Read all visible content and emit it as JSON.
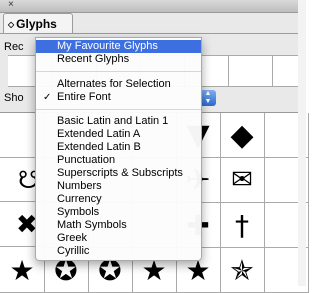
{
  "panel": {
    "close_glyph": "×",
    "tab_arrows": "◇",
    "tab_title": "Glyphs",
    "recent_label": "Rec",
    "show_label": "Sho",
    "stepper_up": "▲",
    "stepper_down": "▼"
  },
  "menu": {
    "group1": [
      {
        "label": "My Favourite Glyphs",
        "selected": true
      },
      {
        "label": "Recent Glyphs",
        "selected": false
      }
    ],
    "group2": [
      {
        "label": "Alternates for Selection",
        "checked": false
      },
      {
        "label": "Entire Font",
        "checked": true
      }
    ],
    "group3": [
      "Basic Latin and Latin 1",
      "Extended Latin A",
      "Extended Latin B",
      "Punctuation",
      "Superscripts & Subscripts",
      "Numbers",
      "Currency",
      "Symbols",
      "Math Symbols",
      "Greek",
      "Cyrillic"
    ],
    "check_glyph": "✓"
  },
  "grid_glyphs": {
    "r1c5": "▼",
    "r1c6": "◆",
    "r2c1": "☋",
    "r2c5": "✈",
    "r2c6": "✉",
    "r3c1": "✖",
    "r3c5": "✚",
    "r3c6": "†",
    "r4c1": "★",
    "r4c2": "✪",
    "r4c3": "✪",
    "r4c4": "★",
    "r4c5": "★",
    "r4c6": "✯"
  },
  "colors": {
    "selection": "#3d6fe0",
    "stepper": "#2a6ad0"
  }
}
